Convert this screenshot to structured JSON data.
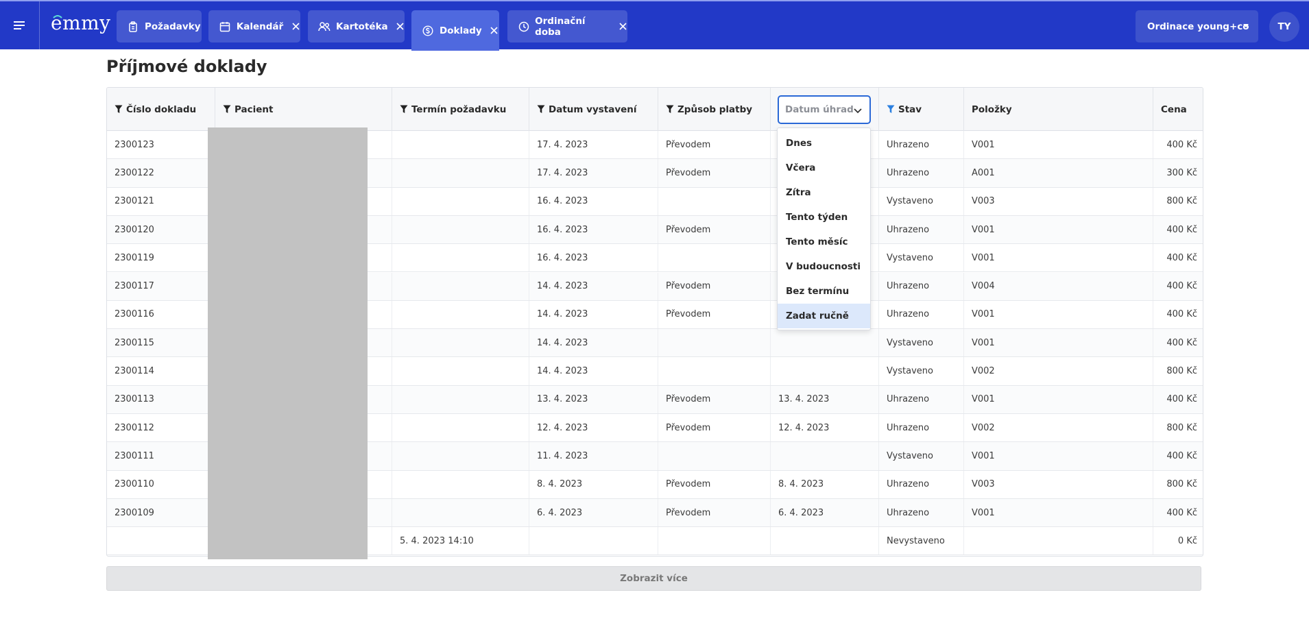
{
  "app": {
    "logo_text": "emmy",
    "tabs": [
      {
        "label": "Požadavky",
        "icon": "clipboard-icon",
        "closable": false
      },
      {
        "label": "Kalendář",
        "icon": "calendar-icon",
        "closable": true
      },
      {
        "label": "Kartotéka",
        "icon": "users-icon",
        "closable": true
      },
      {
        "label": "Doklady",
        "icon": "dollar-circle-icon",
        "closable": true,
        "active": true
      },
      {
        "label": "Ordinační doba",
        "icon": "clock-icon",
        "closable": true
      }
    ],
    "practice_label": "Ordinace young+co",
    "avatar_initials": "TY",
    "colors": {
      "topbar": "#2239c7",
      "tab": "#4458d0",
      "tab_active": "#4f69df",
      "filter_active": "#2a68d6"
    }
  },
  "page": {
    "title": "Příjmové doklady",
    "more_button": "Zobrazit více"
  },
  "table": {
    "columns": [
      {
        "key": "cislo",
        "label": "Číslo dokladu",
        "filter": true
      },
      {
        "key": "pacient",
        "label": "Pacient",
        "filter": true
      },
      {
        "key": "termin",
        "label": "Termín požadavku",
        "filter": true
      },
      {
        "key": "vystaveni",
        "label": "Datum vystavení",
        "filter": true
      },
      {
        "key": "platba",
        "label": "Způsob platby",
        "filter": true
      },
      {
        "key": "uhrada",
        "label": "",
        "filter": false
      },
      {
        "key": "stav",
        "label": "Stav",
        "filter": true,
        "filter_active": true
      },
      {
        "key": "polozky",
        "label": "Položky",
        "filter": false
      },
      {
        "key": "cena",
        "label": "Cena",
        "filter": false
      }
    ],
    "date_filter_placeholder": "Datum úhrad",
    "rows": [
      {
        "cislo": "2300123",
        "termin": "",
        "vystaveni": "17. 4. 2023",
        "platba": "Převodem",
        "uhrada": "",
        "stav": "Uhrazeno",
        "polozky": "V001",
        "cena": "400 Kč"
      },
      {
        "cislo": "2300122",
        "termin": "",
        "vystaveni": "17. 4. 2023",
        "platba": "Převodem",
        "uhrada": "",
        "stav": "Uhrazeno",
        "polozky": "A001",
        "cena": "300 Kč"
      },
      {
        "cislo": "2300121",
        "termin": "",
        "vystaveni": "16. 4. 2023",
        "platba": "",
        "uhrada": "",
        "stav": "Vystaveno",
        "polozky": "V003",
        "cena": "800 Kč"
      },
      {
        "cislo": "2300120",
        "termin": "",
        "vystaveni": "16. 4. 2023",
        "platba": "Převodem",
        "uhrada": "",
        "stav": "Uhrazeno",
        "polozky": "V001",
        "cena": "400 Kč"
      },
      {
        "cislo": "2300119",
        "termin": "",
        "vystaveni": "16. 4. 2023",
        "platba": "",
        "uhrada": "",
        "stav": "Vystaveno",
        "polozky": "V001",
        "cena": "400 Kč"
      },
      {
        "cislo": "2300117",
        "termin": "",
        "vystaveni": "14. 4. 2023",
        "platba": "Převodem",
        "uhrada": "",
        "stav": "Uhrazeno",
        "polozky": "V004",
        "cena": "400 Kč"
      },
      {
        "cislo": "2300116",
        "termin": "",
        "vystaveni": "14. 4. 2023",
        "platba": "Převodem",
        "uhrada": "",
        "stav": "Uhrazeno",
        "polozky": "V001",
        "cena": "400 Kč"
      },
      {
        "cislo": "2300115",
        "termin": "",
        "vystaveni": "14. 4. 2023",
        "platba": "",
        "uhrada": "",
        "stav": "Vystaveno",
        "polozky": "V001",
        "cena": "400 Kč"
      },
      {
        "cislo": "2300114",
        "termin": "",
        "vystaveni": "14. 4. 2023",
        "platba": "",
        "uhrada": "",
        "stav": "Vystaveno",
        "polozky": "V002",
        "cena": "800 Kč"
      },
      {
        "cislo": "2300113",
        "termin": "",
        "vystaveni": "13. 4. 2023",
        "platba": "Převodem",
        "uhrada": "13. 4. 2023",
        "stav": "Uhrazeno",
        "polozky": "V001",
        "cena": "400 Kč"
      },
      {
        "cislo": "2300112",
        "termin": "",
        "vystaveni": "12. 4. 2023",
        "platba": "Převodem",
        "uhrada": "12. 4. 2023",
        "stav": "Uhrazeno",
        "polozky": "V002",
        "cena": "800 Kč"
      },
      {
        "cislo": "2300111",
        "termin": "",
        "vystaveni": "11. 4. 2023",
        "platba": "",
        "uhrada": "",
        "stav": "Vystaveno",
        "polozky": "V001",
        "cena": "400 Kč"
      },
      {
        "cislo": "2300110",
        "termin": "",
        "vystaveni": "8. 4. 2023",
        "platba": "Převodem",
        "uhrada": "8. 4. 2023",
        "stav": "Uhrazeno",
        "polozky": "V003",
        "cena": "800 Kč"
      },
      {
        "cislo": "2300109",
        "termin": "",
        "vystaveni": "6. 4. 2023",
        "platba": "Převodem",
        "uhrada": "6. 4. 2023",
        "stav": "Uhrazeno",
        "polozky": "V001",
        "cena": "400 Kč"
      },
      {
        "cislo": "",
        "termin": "5. 4. 2023 14:10",
        "vystaveni": "",
        "platba": "",
        "uhrada": "",
        "stav": "Nevystaveno",
        "polozky": "",
        "cena": "0 Kč"
      }
    ]
  },
  "date_dropdown": {
    "options": [
      "Dnes",
      "Včera",
      "Zítra",
      "Tento týden",
      "Tento měsíc",
      "V budoucnosti",
      "Bez termínu",
      "Zadat ručně"
    ],
    "highlighted": "Zadat ručně"
  }
}
